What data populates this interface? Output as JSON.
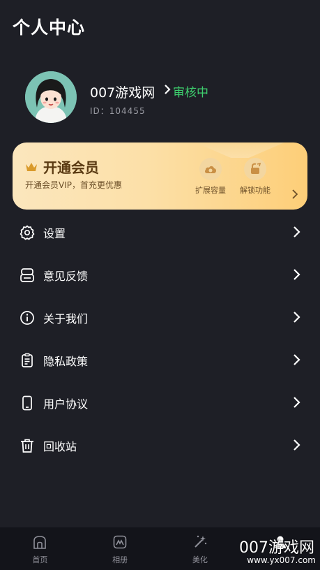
{
  "header": {
    "title": "个人中心"
  },
  "profile": {
    "username": "007游戏网",
    "status": "审核中",
    "id_label": "ID：",
    "id_value": "104455"
  },
  "vip": {
    "title": "开通会员",
    "subtitle": "开通会员VIP，首充更优惠",
    "features": [
      "扩展容量",
      "解锁功能"
    ]
  },
  "menu": {
    "items": [
      {
        "label": "设置",
        "icon": "gear-icon"
      },
      {
        "label": "意见反馈",
        "icon": "feedback-icon"
      },
      {
        "label": "关于我们",
        "icon": "info-icon"
      },
      {
        "label": "隐私政策",
        "icon": "privacy-icon"
      },
      {
        "label": "用户协议",
        "icon": "phone-icon"
      },
      {
        "label": "回收站",
        "icon": "trash-icon"
      }
    ]
  },
  "tabbar": {
    "tabs": [
      {
        "label": "首页",
        "icon": "home-icon"
      },
      {
        "label": "相册",
        "icon": "album-icon"
      },
      {
        "label": "美化",
        "icon": "magic-wand-icon"
      },
      {
        "label": "",
        "icon": "person-icon"
      }
    ]
  },
  "watermark": {
    "text": "007游戏网",
    "url": "www.yx007.com"
  },
  "colors": {
    "background": "#1e1f26",
    "status_green": "#3ecf6e",
    "vip_gold": "#fdce78"
  }
}
